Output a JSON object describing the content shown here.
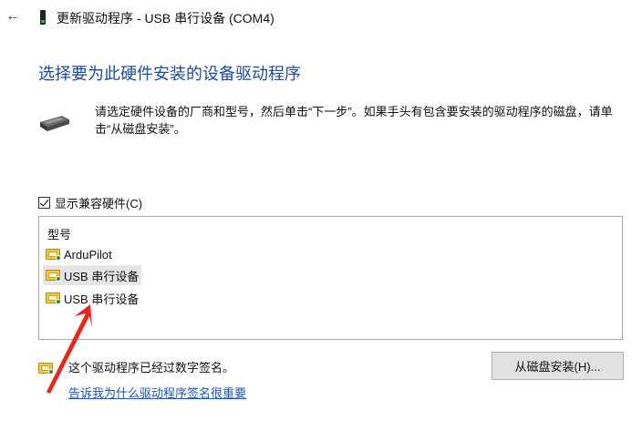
{
  "window": {
    "back_icon": "back-arrow-icon",
    "device_icon": "usb-device-icon",
    "title": "更新驱动程序 - USB 串行设备 (COM4)"
  },
  "heading": "选择要为此硬件安装的设备驱动程序",
  "instruction": {
    "icon": "hardware-card-icon",
    "text": "请选定硬件设备的厂商和型号，然后单击“下一步”。如果手头有包含要安装的驱动程序的磁盘，请单击“从磁盘安装”。"
  },
  "compat_checkbox": {
    "checked": true,
    "label": "显示兼容硬件(C)"
  },
  "model_list": {
    "header": "型号",
    "items": [
      {
        "label": "ArduPilot",
        "icon": "signed-driver-icon",
        "selected": false
      },
      {
        "label": "USB 串行设备",
        "icon": "signed-driver-icon",
        "selected": true
      },
      {
        "label": "USB 串行设备",
        "icon": "signed-driver-icon",
        "selected": false
      }
    ]
  },
  "signature": {
    "icon": "signed-driver-icon",
    "text": "这个驱动程序已经过数字签名。",
    "link": "告诉我为什么驱动程序签名很重要"
  },
  "buttons": {
    "have_disk": "从磁盘安装(H)..."
  },
  "colors": {
    "heading": "#1c4c9a",
    "link": "#1a56b8",
    "annotation_arrow": "#e8261c",
    "selection": "#e5e5e5"
  }
}
